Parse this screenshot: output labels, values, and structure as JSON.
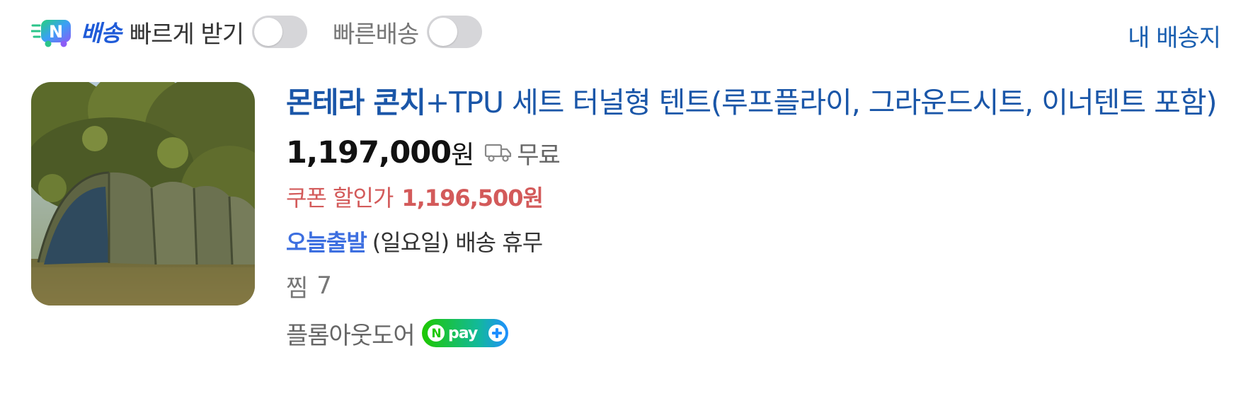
{
  "header": {
    "badge_icon": "n-delivery-truck-icon",
    "badge_text": "배송",
    "fast_receive_label": "빠르게 받기",
    "fast_receive_on": false,
    "fast_delivery_label": "빠른배송",
    "fast_delivery_on": false,
    "my_address_link": "내 배송지"
  },
  "product": {
    "image_alt": "tent photo",
    "title_bold": "몬테라 콘치",
    "title_rest": "+TPU 세트 터널형 텐트(루프플라이, 그라운드시트, 이너텐트 포함)",
    "price": "1,197,000",
    "price_unit": "원",
    "shipping_icon": "truck-icon",
    "shipping_text": "무료",
    "coupon_label": "쿠폰 할인가",
    "coupon_price": "1,196,500원",
    "today_label": "오늘출발",
    "today_detail": "(일요일) 배송 휴무",
    "zzim_label": "찜",
    "zzim_count": "7",
    "seller": "플롬아웃도어",
    "npay_icon": "npay-plus-icon"
  },
  "colors": {
    "title": "#1a56a8",
    "coupon": "#d35a5a",
    "today": "#3d6fe0",
    "toggle_off": "#d6d6d9",
    "npay_green": "#1ec800",
    "npay_blue": "#1f8fff"
  }
}
